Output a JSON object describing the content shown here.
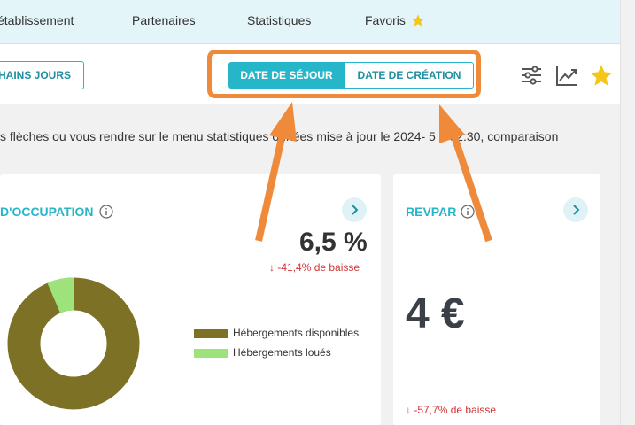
{
  "nav": {
    "items": [
      "établissement",
      "Partenaires",
      "Statistiques",
      "Favoris"
    ],
    "favoris_icon": "star-icon",
    "accent": "#27b6c9"
  },
  "toolbar": {
    "prochains_label": "HAINS JOURS",
    "tab_sejour": "DATE DE SÉJOUR",
    "tab_creation": "DATE DE CRÉATION",
    "icons": [
      "sliders-icon",
      "trend-chart-icon",
      "star-icon"
    ],
    "highlight_color": "#ee8a3a"
  },
  "info_text": "s flèches ou vous rendre sur le menu statistiques  onnées mise à jour le 2024-    5 à 02:30, comparaison",
  "occupation": {
    "title": "D'OCCUPATION",
    "value": "6,5 %",
    "trend": "-41,4% de baisse",
    "legend": [
      {
        "label": "Hébergements disponibles",
        "color": "#7d7126"
      },
      {
        "label": "Hébergements loués",
        "color": "#9de27a"
      }
    ],
    "donut": {
      "disponibles": 93.5,
      "loues": 6.5
    }
  },
  "revpar": {
    "title": "REVPAR",
    "value": "4 €",
    "trend": "-57,7% de baisse"
  }
}
